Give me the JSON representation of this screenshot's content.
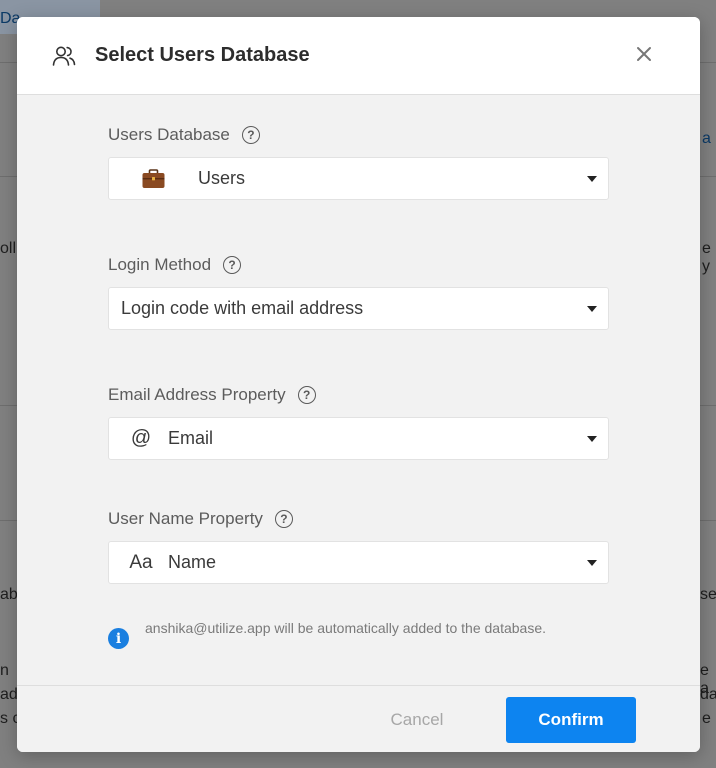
{
  "background": {
    "fragments": [
      {
        "text": "Da"
      },
      {
        "text": "a"
      },
      {
        "text": "oll"
      },
      {
        "text": "e y"
      },
      {
        "text": "ab"
      },
      {
        "text": "se"
      },
      {
        "text": "n"
      },
      {
        "text": "e a"
      },
      {
        "text": "ad"
      },
      {
        "text": "da"
      },
      {
        "text": "s c"
      },
      {
        "text": "e"
      }
    ]
  },
  "modal": {
    "title": "Select Users Database",
    "title_icon": "users-icon",
    "close_icon": "close-icon"
  },
  "fields": {
    "users_database": {
      "label": "Users Database",
      "value": "Users",
      "icon": "briefcase-icon"
    },
    "login_method": {
      "label": "Login Method",
      "value": "Login code with email address"
    },
    "email_property": {
      "label": "Email Address Property",
      "value": "Email",
      "icon_glyph": "@"
    },
    "username_property": {
      "label": "User Name Property",
      "value": "Name",
      "icon_glyph": "Aa"
    }
  },
  "info": {
    "text": "anshika@utilize.app will be automatically added to the database."
  },
  "footer": {
    "cancel_label": "Cancel",
    "confirm_label": "Confirm"
  },
  "colors": {
    "accent": "#0d84f0",
    "info_icon": "#1a7fe0",
    "modal_bg": "#f2f2f2",
    "backdrop": "#808080"
  }
}
